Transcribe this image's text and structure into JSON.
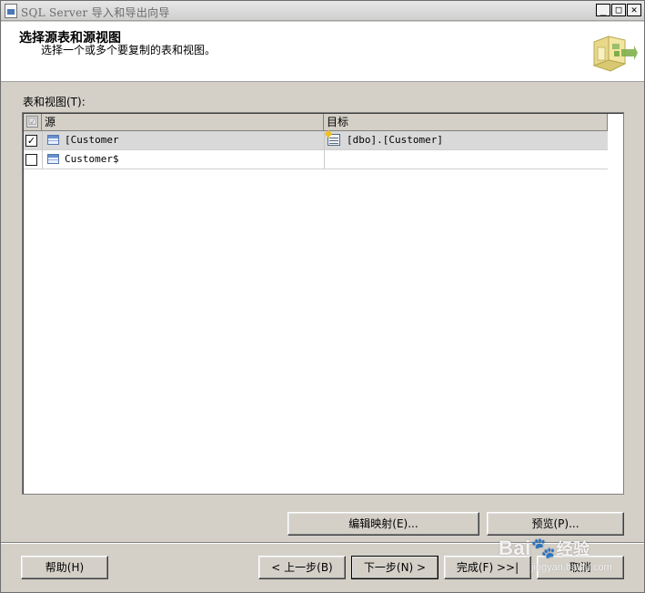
{
  "window": {
    "title": "SQL Server 导入和导出向导",
    "min_glyph": "_",
    "max_glyph": "□",
    "close_glyph": "✕"
  },
  "header": {
    "title": "选择源表和源视图",
    "subtitle": "选择一个或多个要复制的表和视图。",
    "art_icon": "wizard-export-icon"
  },
  "tables": {
    "label": "表和视图(T):",
    "columns": {
      "source": "源",
      "target": "目标"
    },
    "header_check": "☑",
    "rows": [
      {
        "checked": "✓",
        "source": "[Customer",
        "target": "[dbo].[Customer]",
        "source_icon": "table-icon",
        "target_icon": "new-table-icon"
      },
      {
        "checked": "",
        "source": "Customer$",
        "target": "",
        "source_icon": "table-icon",
        "target_icon": ""
      }
    ]
  },
  "buttons": {
    "edit_mappings": "编辑映射(E)...",
    "preview": "预览(P)...",
    "help": "帮助(H)",
    "back": "< 上一步(B)",
    "next": "下一步(N) >",
    "finish": "完成(F) >>|",
    "cancel": "取消"
  },
  "watermark": {
    "brand": "Bai",
    "brand_cn": "经验",
    "url": "jingyan.baidu.com"
  },
  "colors": {
    "face": "#d4d0c8",
    "selected_row": "#d9d9d9"
  }
}
